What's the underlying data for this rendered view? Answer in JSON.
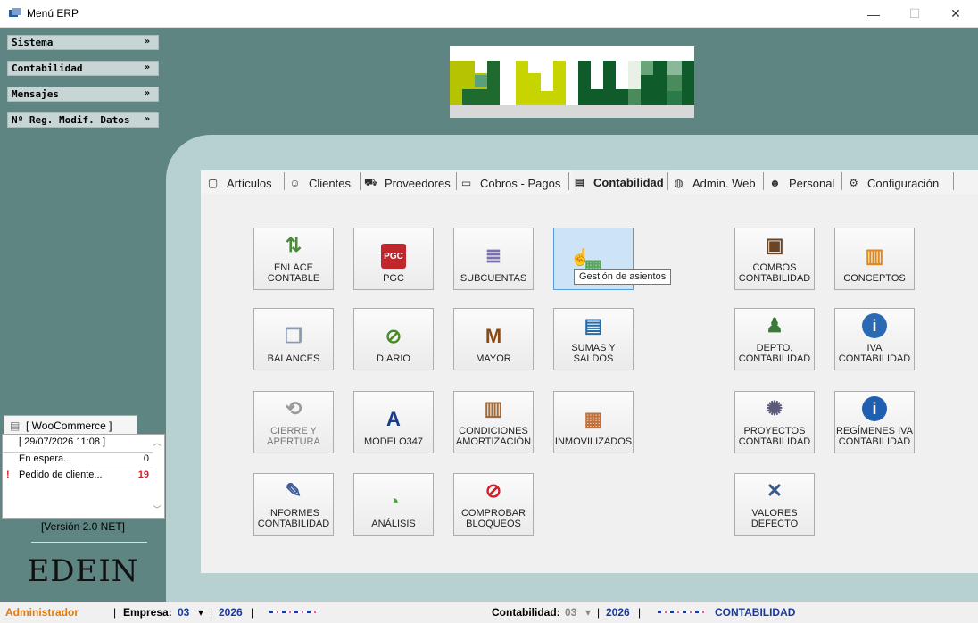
{
  "window": {
    "title": "Menú ERP"
  },
  "sidebar": {
    "items": [
      {
        "label": "Sistema",
        "chevron": "»"
      },
      {
        "label": "Contabilidad",
        "chevron": "»"
      },
      {
        "label": "Mensajes",
        "chevron": "»"
      },
      {
        "label": "Nº Reg. Modif. Datos",
        "chevron": "»"
      }
    ]
  },
  "tabs": [
    {
      "label": "Artículos",
      "icon": "box-icon",
      "glyph": "▢"
    },
    {
      "label": "Clientes",
      "icon": "person-icon",
      "glyph": "☺"
    },
    {
      "label": "Proveedores",
      "icon": "truck-icon",
      "glyph": "⛟"
    },
    {
      "label": "Cobros - Pagos",
      "icon": "card-icon",
      "glyph": "▭"
    },
    {
      "label": "Contabilidad",
      "icon": "document-icon",
      "glyph": "▤"
    },
    {
      "label": "Admin. Web",
      "icon": "globe-icon",
      "glyph": "◍"
    },
    {
      "label": "Personal",
      "icon": "people-icon",
      "glyph": "☻"
    },
    {
      "label": "Configuración",
      "icon": "gear-icon",
      "glyph": "⚙"
    }
  ],
  "active_tab": "Contabilidad",
  "tiles": [
    {
      "label": "ENLACE\nCONTABLE",
      "icon": "link-icon",
      "glyph": "⇅",
      "color": "#4a8a3a"
    },
    {
      "label": "PGC",
      "icon": "pgc-icon",
      "glyph": "PGC",
      "color": "#c0272d"
    },
    {
      "label": "SUBCUENTAS",
      "icon": "list-icon",
      "glyph": "≣",
      "color": "#7a6fb0"
    },
    {
      "label": "",
      "icon": "journal-entries-icon",
      "glyph": "▦",
      "color": "#5aa55a"
    },
    {
      "label": "COMBOS\nCONTABILIDAD",
      "icon": "drawer-icon",
      "glyph": "▣",
      "color": "#6b4424"
    },
    {
      "label": "CONCEPTOS",
      "icon": "bars-icon",
      "glyph": "▥",
      "color": "#e08a1e"
    },
    {
      "label": "BALANCES",
      "icon": "windows-icon",
      "glyph": "❐",
      "color": "#8a9bb0"
    },
    {
      "label": "DIARIO",
      "icon": "book-icon",
      "glyph": "⊘",
      "color": "#4b8a2a"
    },
    {
      "label": "MAYOR",
      "icon": "ledger-icon",
      "glyph": "M",
      "color": "#8a4a10"
    },
    {
      "label": "SUMAS Y\nSALDOS",
      "icon": "sheet-icon",
      "glyph": "▤",
      "color": "#2a6aa5"
    },
    {
      "label": "DEPTO.\nCONTABILIDAD",
      "icon": "department-icon",
      "glyph": "♟",
      "color": "#3a7a3a"
    },
    {
      "label": "IVA\nCONTABILIDAD",
      "icon": "info-doc-icon",
      "glyph": "i",
      "color": "#2a6ab5"
    },
    {
      "label": "CIERRE Y\nAPERTURA",
      "icon": "close-open-icon",
      "glyph": "⟲",
      "color": "#9a9a9a"
    },
    {
      "label": "MODELO347",
      "icon": "tax-agency-icon",
      "glyph": "A",
      "color": "#1a3a8a"
    },
    {
      "label": "CONDICIONES\nAMORTIZACIÓN",
      "icon": "fence-icon",
      "glyph": "▥",
      "color": "#a06a3a"
    },
    {
      "label": "INMOVILIZADOS",
      "icon": "bricks-icon",
      "glyph": "▦",
      "color": "#c0703a"
    },
    {
      "label": "PROYECTOS\nCONTABILIDAD",
      "icon": "projector-icon",
      "glyph": "✺",
      "color": "#5a5a7a"
    },
    {
      "label": "REGÍMENES IVA\nCONTABILIDAD",
      "icon": "info-icon",
      "glyph": "i",
      "color": "#1e5fb0"
    },
    {
      "label": "INFORMES\nCONTABILIDAD",
      "icon": "report-icon",
      "glyph": "✎",
      "color": "#3a5a9a"
    },
    {
      "label": "ANÁLISIS",
      "icon": "pie-chart-icon",
      "glyph": "◔",
      "color": "#4aa53a"
    },
    {
      "label": "COMPROBAR\nBLOQUEOS",
      "icon": "forbidden-icon",
      "glyph": "⊘",
      "color": "#d0202a"
    },
    {
      "label": "VALORES\nDEFECTO",
      "icon": "tools-icon",
      "glyph": "✕",
      "color": "#3a5a8a"
    }
  ],
  "tooltip": "Gestión de asientos",
  "woocommerce": {
    "tab_label": "[ WooCommerce ]",
    "datetime": "[ 29/07/2026 11:08 ]",
    "rows": [
      {
        "flag": "",
        "label": "En espera...",
        "value": "0"
      },
      {
        "flag": "!",
        "label": "Pedido de cliente...",
        "value": "19"
      }
    ]
  },
  "version": "[Versión 2.0 NET]",
  "brand": "EDEIN",
  "status": {
    "user": "Administrador",
    "empresa_label": "Empresa:",
    "empresa_code": "03",
    "empresa_year": "2026",
    "contabilidad_label": "Contabilidad:",
    "contabilidad_code": "03",
    "contabilidad_year": "2026",
    "contabilidad_name": "CONTABILIDAD",
    "separator": "|",
    "dropdown": "▾"
  },
  "colors": {
    "background": "#5e8582",
    "panel": "#b7d1d0",
    "accent_user": "#e07a10",
    "accent_blue": "#1a3a9a",
    "alert": "#d0202a"
  }
}
